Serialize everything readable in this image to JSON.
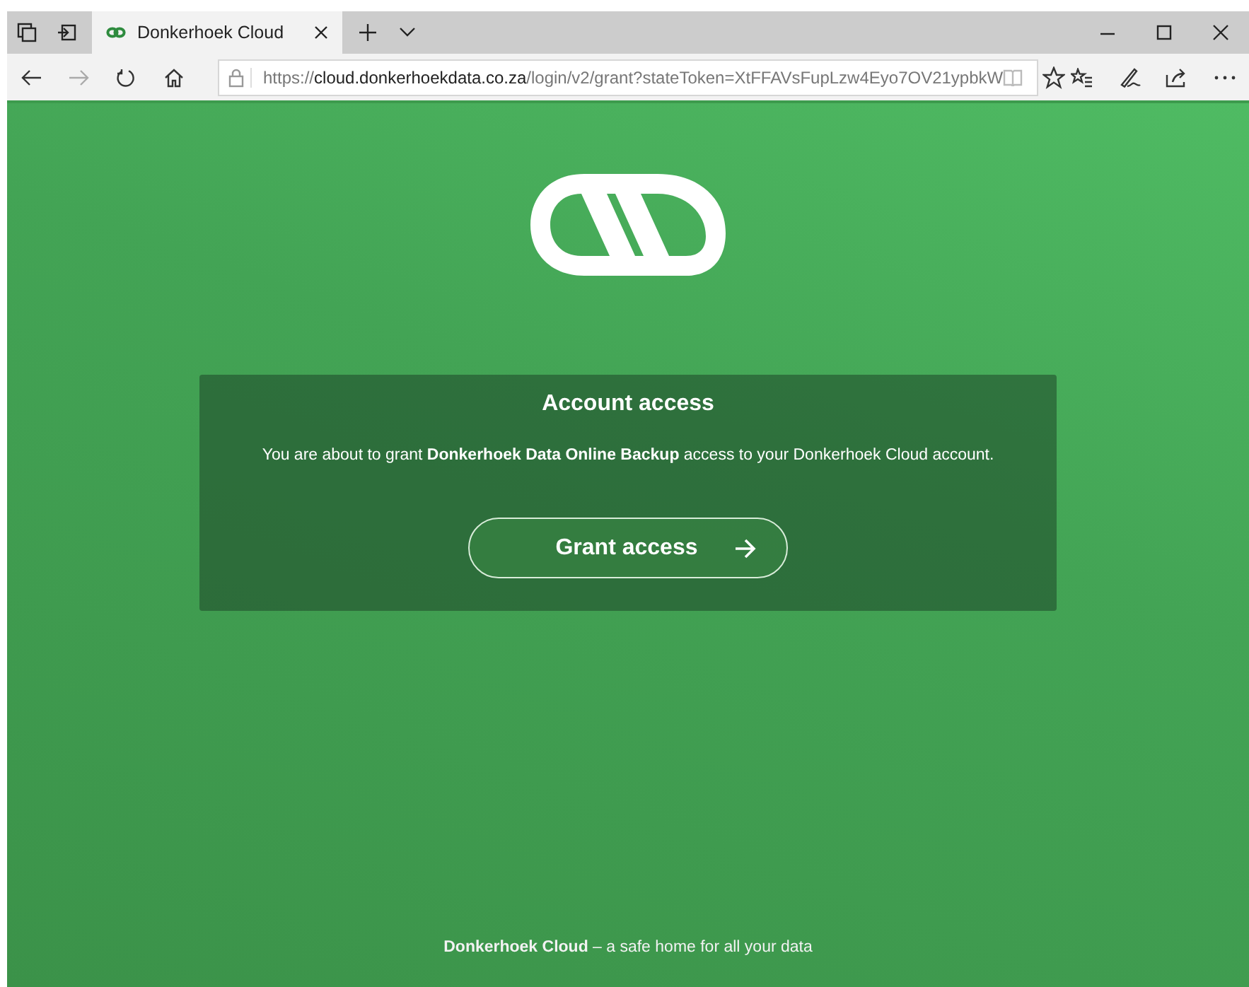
{
  "browser": {
    "tab": {
      "title": "Donkerhoek Cloud",
      "selected": true
    },
    "address": {
      "scheme": "https://",
      "host": "cloud.donkerhoekdata.co.za",
      "path": "/login/v2/grant?stateToken=XtFFAVsFupLzw4Eyo7OV21ypbkW"
    }
  },
  "card": {
    "title": "Account access",
    "message": "You are about to grant **Donkerhoek Data Online Backup** access to your Donkerhoek Cloud account.",
    "button": "Grant access"
  },
  "footer": "**Donkerhoek Cloud** – a safe home for all your data"
}
